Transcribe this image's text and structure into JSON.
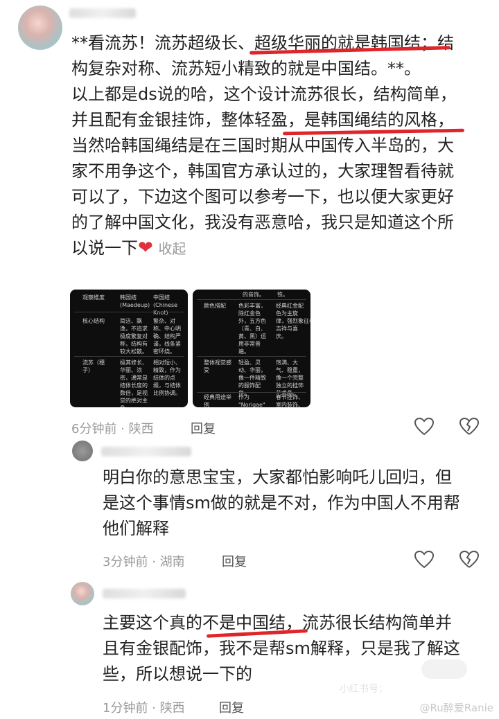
{
  "comment1": {
    "lines": [
      "**看流苏！流苏超级长、超级华丽的就是韩国结；结",
      "构复杂对称、流苏短小精致的就是中国结。**。",
      "以上都是ds说的哈，这个设计流苏很长，结构简单，",
      "并且配有金银挂饰，整体轻盈，是韩国绳结的风格，",
      "当然哈韩国绳结是在三国时期从中国传入半岛的，大",
      "家不用争这个，韩国官方承认过的，大家理智看待就",
      "可以了，下边这个图可以参考一下，也以便大家更好",
      "的了解中国文化，我没有恶意哈，我只是知道这个所",
      "以说一下"
    ],
    "heart_emoji": "❤",
    "collapse_label": "收起",
    "time_location": "6分钟前 · 陕西",
    "reply_label": "回复",
    "table1": {
      "headers": [
        "观察维度",
        "韩国结\n(Maedeup)",
        "中国结\n(Chinese\nKnot)"
      ],
      "rows": [
        [
          "核心结构",
          "简洁、飘\n逸，不追求\n极度繁复对\n称，结构有\n较大松散。",
          "繁杂、对\n称、中心明\n确、结构严\n谨，线条紧\n密环绕。"
        ],
        [
          "流苏（穗\n子）",
          "极其修长、\n华丽、浓\n密，通常是\n结体长度的\n数倍，是视\n觉的绝对主\n角。",
          "相对短小、\n精致，作为\n结体的点\n缀，与结体\n比例协调。"
        ]
      ]
    },
    "table2": {
      "top_fragment": [
        "的音饰。",
        "铁。"
      ],
      "rows": [
        [
          "颜色搭配",
          "色彩丰富，\n除红金色\n外，五方色\n（青、白、\n黄、黑）运\n用非常普\n遍。",
          "经典红金配\n色为主旋\n律，强烈象征着\n吉祥与喜\n庆。"
        ],
        [
          "整体视觉感\n受",
          "轻盈、灵\n动、华丽，\n像一件精致\n的服饰配\n件。",
          "饱满、大\n气、稳重，\n像一个完整\n独立的挂饰\n艺术品。"
        ],
        [
          "经典用途举\n例",
          "作为\n\"Norigae\"",
          "春节挂饰、\n室内装饰、"
        ]
      ]
    }
  },
  "reply1": {
    "lines": [
      "明白你的意思宝宝，大家都怕影响吒儿回归，但",
      "是这个事情sm做的就是不对，作为中国人不用帮",
      "他们解释"
    ],
    "time_location": "3分钟前 · 湖南",
    "reply_label": "回复"
  },
  "reply2": {
    "lines": [
      "主要这个真的不是中国结，流苏很长结构简单并",
      "且有金银配饰，我不是帮sm解释，只是我了解这",
      "些，所以想说一下的"
    ],
    "time_location": "1分钟前 · 陕西",
    "reply_label": "回复"
  },
  "watermark": "@Ru醉爱Ranie",
  "watermark2": "小红书号：",
  "colors": {
    "underline_red": "#e0252a",
    "meta_gray": "#9a9a9a",
    "table_bg": "#0e0e0e"
  }
}
